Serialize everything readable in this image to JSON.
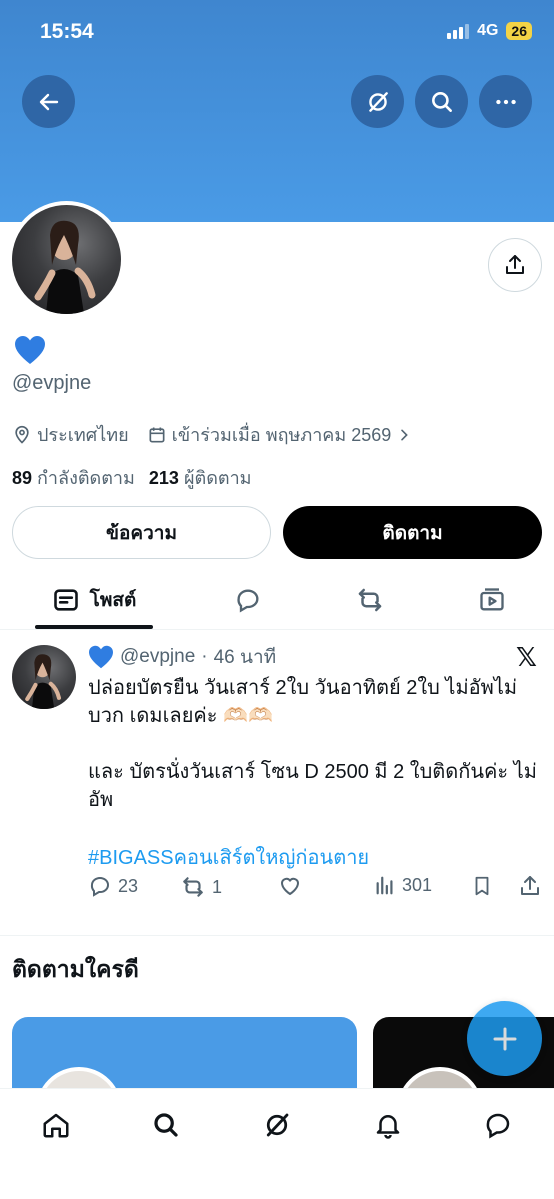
{
  "status_bar": {
    "time": "15:54",
    "network": "4G",
    "battery": "26"
  },
  "header": {
    "back_icon": "arrow-left-icon",
    "grok_icon": "slash-circle-icon",
    "search_icon": "search-icon",
    "more_icon": "more-icon"
  },
  "profile": {
    "name_emoji": "💙",
    "handle": "@evpjne",
    "location": "ประเทศไทย",
    "joined": "เข้าร่วมเมื่อ พฤษภาคม 2569",
    "following_count": "89",
    "following_label": "กำลังติดตาม",
    "followers_count": "213",
    "followers_label": "ผู้ติดตาม",
    "message_button": "ข้อความ",
    "follow_button": "ติดตาม"
  },
  "tabs": {
    "posts_label": "โพสต์"
  },
  "post": {
    "name_emoji": "💙",
    "handle": "@evpjne",
    "separator": "·",
    "time": "46 นาที",
    "text": "ปล่อยบัตรยืน วันเสาร์ 2ใบ วันอาทิตย์ 2ใบ ไม่อัพไม่บวก เดมเลยค่ะ 🫶🏻🫶🏻\n\nและ บัตรนั่งวันเสาร์ โซน D 2500 มี 2 ใบติดกันค่ะ ไม่อัพ",
    "hashtag": "#BIGASSคอนเสิร์ตใหญ่ก่อนตาย",
    "replies": "23",
    "reposts": "1",
    "views": "301"
  },
  "who_to_follow": {
    "title": "ติดตามใครดี"
  },
  "colors": {
    "accent": "#1d9bf0",
    "banner": "#4a9be6",
    "text": "#0f1419",
    "muted": "#536471"
  }
}
